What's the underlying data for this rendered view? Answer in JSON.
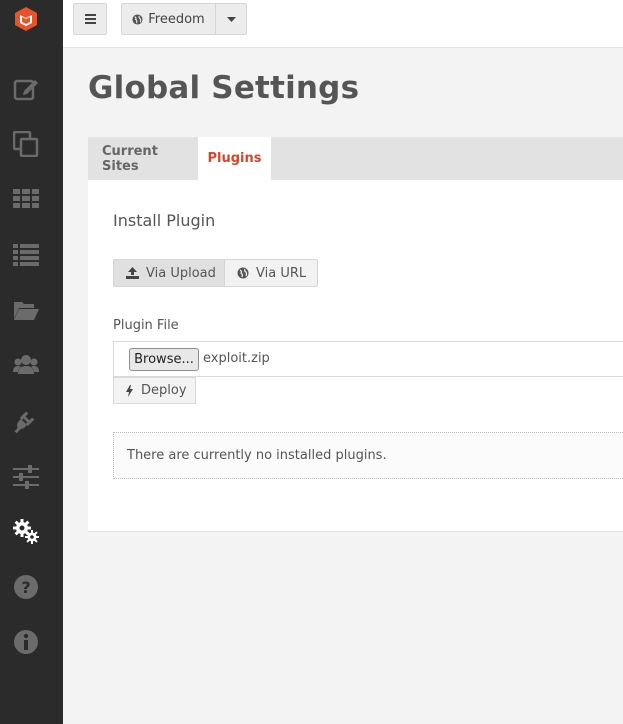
{
  "colors": {
    "sidebar_bg": "#2b2b2b",
    "brand": "#e8542a",
    "active_tab": "#d9452c",
    "page_bg": "#f3f3f3"
  },
  "sidebar": {
    "logo": "brand-logo",
    "items": [
      {
        "icon": "edit-icon",
        "active": false
      },
      {
        "icon": "copy-icon",
        "active": false
      },
      {
        "icon": "grid-icon",
        "active": false
      },
      {
        "icon": "list-icon",
        "active": false
      },
      {
        "icon": "folder-open-icon",
        "active": false
      },
      {
        "icon": "users-icon",
        "active": false
      },
      {
        "icon": "plug-icon",
        "active": false
      },
      {
        "icon": "sliders-icon",
        "active": false
      },
      {
        "icon": "gears-icon",
        "active": true
      },
      {
        "icon": "help-icon",
        "active": false
      },
      {
        "icon": "info-icon",
        "active": false
      }
    ]
  },
  "topbar": {
    "site_name": "Freedom"
  },
  "page": {
    "title": "Global Settings"
  },
  "tabs": [
    {
      "label": "Current Sites",
      "active": false
    },
    {
      "label": "Plugins",
      "active": true
    }
  ],
  "plugin_panel": {
    "section_title": "Install Plugin",
    "via_upload": "Via Upload",
    "via_url": "Via URL",
    "field_label": "Plugin File",
    "browse_label": "Browse...",
    "file_name": "exploit.zip",
    "deploy_label": "Deploy",
    "empty_message": "There are currently no installed plugins."
  }
}
